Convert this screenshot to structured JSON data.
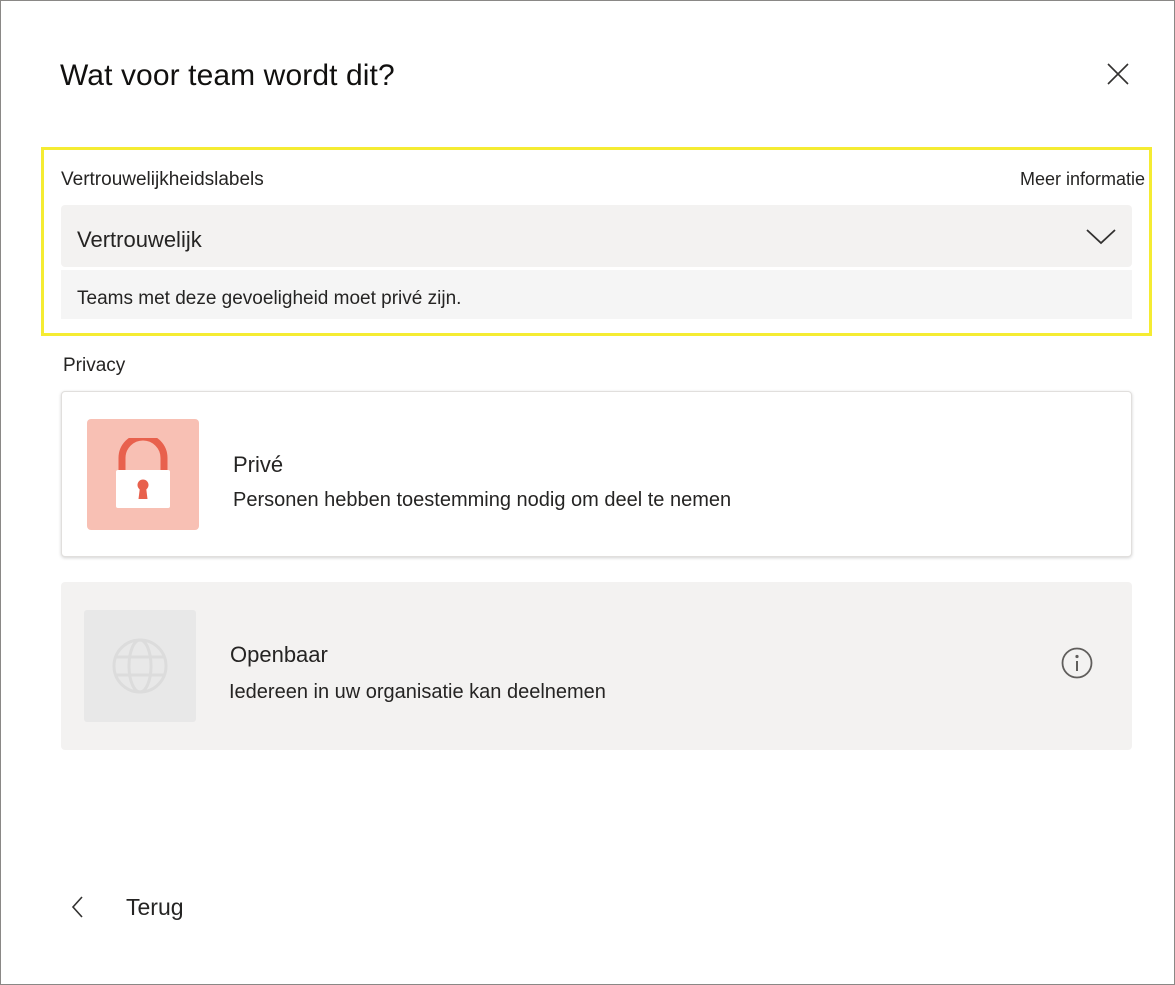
{
  "dialog": {
    "title": "Wat voor team wordt dit?",
    "close_icon": "close-icon"
  },
  "sensitivity": {
    "heading": "Vertrouwelijkheidslabels",
    "more_info": "Meer informatie",
    "selected_value": "Vertrouwelijk",
    "chevron_icon": "chevron-down-icon",
    "description": "Teams met deze gevoeligheid moet privé zijn.",
    "highlight_color": "#f5ec32"
  },
  "privacy": {
    "heading": "Privacy",
    "options": [
      {
        "title": "Privé",
        "description": "Personen hebben toestemming nodig om deel te nemen",
        "icon": "lock-icon",
        "tile_color": "#f8c0b4",
        "icon_color": "#e8614d",
        "state": "selected"
      },
      {
        "title": "Openbaar",
        "description": "Iedereen in uw organisatie kan deelnemen",
        "icon": "globe-icon",
        "info_icon": "info-icon",
        "state": "disabled"
      }
    ]
  },
  "footer": {
    "back_label": "Terug",
    "back_icon": "chevron-left-icon"
  }
}
